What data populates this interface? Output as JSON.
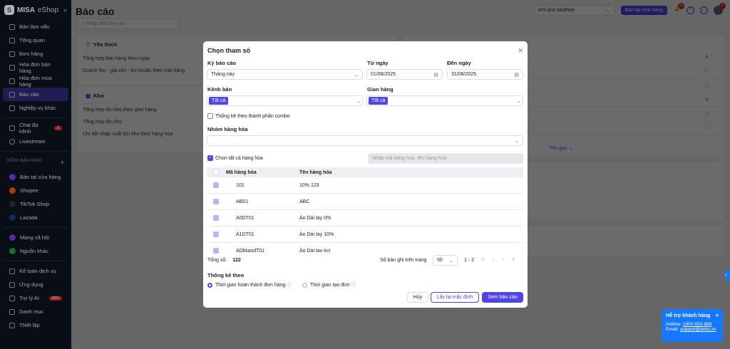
{
  "brand": {
    "name": "MISA",
    "suffix": "eShop"
  },
  "sidebar": {
    "items": [
      {
        "label": "Bàn làm việc"
      },
      {
        "label": "Tổng quan"
      },
      {
        "label": "Đơn hàng"
      },
      {
        "label": "Hóa đơn bán hàng"
      },
      {
        "label": "Hóa đơn mua hàng"
      },
      {
        "label": "Báo cáo"
      },
      {
        "label": "Nghiệp vụ khác"
      }
    ],
    "chat": {
      "label": "Chat đa kênh",
      "badge": "2"
    },
    "livestream": "Livestream",
    "channels_title": "KÊNH BÁN HÀNG",
    "channels_add": "+",
    "channels": [
      {
        "label": "Bán tại cửa hàng",
        "color": "#7c3aed"
      },
      {
        "label": "Shopee",
        "color": "#ea580c"
      },
      {
        "label": "TikTok Shop",
        "color": "#333333"
      },
      {
        "label": "Lazada",
        "color": "#1e3a8a"
      }
    ],
    "social": [
      {
        "label": "Mạng xã hội",
        "color": "#7c3aed"
      },
      {
        "label": "Nguồn khác",
        "color": "#16a34a"
      }
    ],
    "bottom": [
      {
        "label": "Kế toán dịch vụ"
      },
      {
        "label": "Ứng dụng"
      },
      {
        "label": "Trợ lý AI",
        "badge": "Mới"
      },
      {
        "label": "Danh mục"
      },
      {
        "label": "Thiết lập"
      }
    ]
  },
  "page": {
    "title": "Báo cáo",
    "search_placeholder": "Nhập tên báo cáo",
    "favorites": {
      "title": "Yêu thích",
      "items": [
        "Tổng hợp bán hàng theo ngày",
        "Doanh thu - giá vốn - lợi nhuận theo mặt hàng"
      ]
    },
    "warehouse": {
      "title": "Kho",
      "items": [
        "Tổng hợp tồn kho theo gian hàng",
        "Tổng hợp tồn kho",
        "Chi tiết nhập xuất tồn kho theo hàng hóa"
      ]
    },
    "collapse_label": "Thu gọn ⌄"
  },
  "topbar": {
    "store": "omi-pro-sauthue",
    "store_button": "Bán tại cửa hàng",
    "notif_count": "21",
    "avatar_badge": "1"
  },
  "modal": {
    "title": "Chọn tham số",
    "period_label": "Kỳ báo cáo",
    "period_value": "Tháng này",
    "from_label": "Từ ngày",
    "from_value": "01/08/2025",
    "to_label": "Đến ngày",
    "to_value": "31/08/2025",
    "channel_label": "Kênh bán",
    "channel_tag": "Tất cả",
    "shop_label": "Gian hàng",
    "shop_tag": "Tất cả",
    "combo_label": "Thống kê theo thành phần combo",
    "group_label": "Nhóm hàng hóa",
    "select_all_label": "Chọn tất cả hàng hóa",
    "product_search_placeholder": "Nhập mã hàng hóa, tên hàng hóa",
    "columns": [
      "Mã hàng hóa",
      "Tên hàng hóa"
    ],
    "rows": [
      [
        "101",
        "10% 123"
      ],
      [
        "AB01",
        "ABC"
      ],
      [
        "A0DT01",
        "Áo Dài tay 0%"
      ],
      [
        "A1DT01",
        "Áo Dài tay 10%"
      ],
      [
        "ADkkasdT01",
        "Áo Dài tav kct"
      ]
    ],
    "total_label": "Tổng số:",
    "total_value": "122",
    "per_page_label": "Số bản ghi trên trang",
    "per_page": "50",
    "range": "1 - 2",
    "stat_label": "Thống kê theo",
    "stat_options": [
      "Thời gian hoàn thành đơn hàng",
      "Thời gian tạo đơn"
    ],
    "cancel": "Hủy",
    "reset": "Lấy lại mặc định",
    "submit": "Xem báo cáo"
  },
  "support": {
    "title": "Hỗ trợ khách hàng",
    "hotline_label": "Hotline:",
    "hotline": "1900-555-888",
    "email_label": "Email:",
    "email": "support@amis.vn"
  },
  "colors": {
    "accent": "#4f46e5",
    "support": "#1677ff"
  }
}
